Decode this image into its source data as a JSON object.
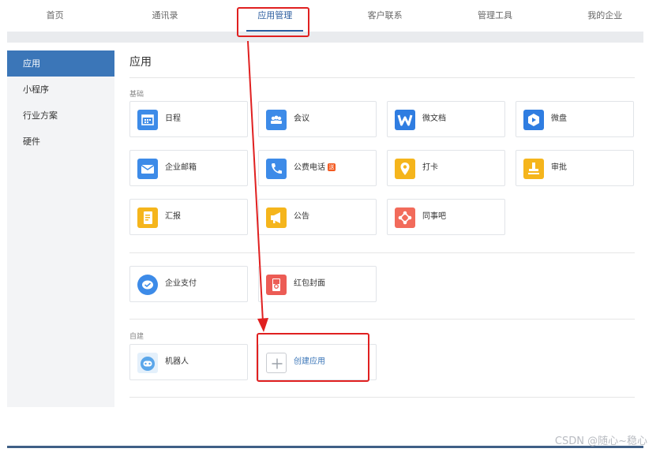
{
  "nav": [
    "首页",
    "通讯录",
    "应用管理",
    "客户联系",
    "管理工具",
    "我的企业"
  ],
  "sidebar": [
    "应用",
    "小程序",
    "行业方案",
    "硬件"
  ],
  "page_title": "应用",
  "sections": {
    "basic": "基础",
    "custom": "自建"
  },
  "apps": {
    "calendar": "日程",
    "meeting": "会议",
    "weidoc": "微文档",
    "weidisk": "微盘",
    "mail": "企业邮箱",
    "phone": "公费电话",
    "checkin": "打卡",
    "approval": "审批",
    "report": "汇报",
    "notice": "公告",
    "tongshiba": "同事吧",
    "pay": "企业支付",
    "redpacket": "红包封面",
    "robot": "机器人",
    "create": "创建应用"
  },
  "phone_badge": "送",
  "watermark": "CSDN @随心~稳心",
  "colors": {
    "accent": "#3b76b8",
    "highlight": "#e02020"
  }
}
